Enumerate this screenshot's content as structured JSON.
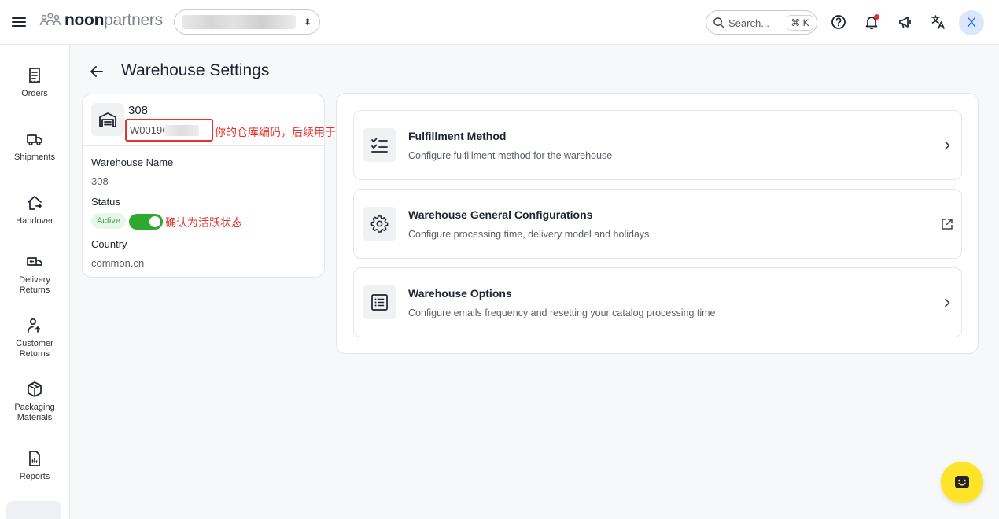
{
  "header": {
    "brand_noon": "noon",
    "brand_partners": "partners",
    "search_placeholder": "Search...",
    "search_shortcut": "⌘ K",
    "avatar_initial": "X",
    "icons": [
      "menu-icon",
      "help-icon",
      "notifications-icon",
      "announcements-icon",
      "translate-icon"
    ]
  },
  "sidebar": {
    "items": [
      {
        "label": "Orders",
        "icon": "receipt-icon"
      },
      {
        "label": "Shipments",
        "icon": "truck-icon"
      },
      {
        "label": "Handover",
        "icon": "handover-icon"
      },
      {
        "label": "Delivery\nReturns",
        "icon": "delivery-return-icon"
      },
      {
        "label": "Customer\nReturns",
        "icon": "customer-return-icon"
      },
      {
        "label": "Packaging\nMaterials",
        "icon": "box-icon"
      },
      {
        "label": "Reports",
        "icon": "report-icon"
      }
    ]
  },
  "page": {
    "title": "Warehouse Settings"
  },
  "warehouse": {
    "code": "308",
    "id_partial": "W0019C",
    "id_annotation": "你的仓库编码，后续用于库存上传",
    "name_label": "Warehouse Name",
    "name_value": "308",
    "status_label": "Status",
    "status_value": "Active",
    "status_on": true,
    "status_annotation": "确认为活跃状态",
    "country_label": "Country",
    "country_value": "common.cn"
  },
  "options": [
    {
      "title": "Fulfillment Method",
      "description": "Configure fulfillment method for the warehouse",
      "icon": "checklist-icon",
      "action": "chevron-right-icon"
    },
    {
      "title": "Warehouse General Configurations",
      "description": "Configure processing time, delivery model and holidays",
      "icon": "gear-icon",
      "action": "external-link-icon"
    },
    {
      "title": "Warehouse Options",
      "description": "Configure emails frequency and resetting your catalog processing time",
      "icon": "list-icon",
      "action": "chevron-right-icon"
    }
  ],
  "colors": {
    "accent_blue": "#2f6bff",
    "active_green": "#2fa82f",
    "annotation_red": "#e5322d",
    "chat_yellow": "#fde428"
  }
}
